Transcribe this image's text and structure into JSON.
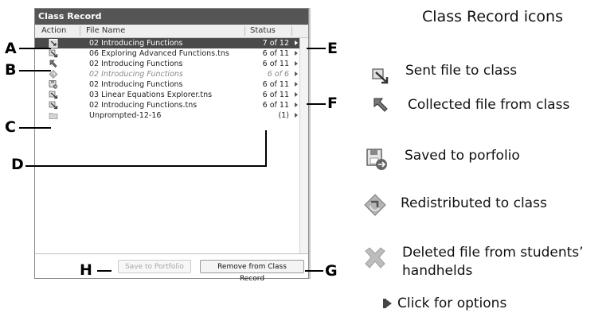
{
  "panel": {
    "title": "Class Record",
    "columns": {
      "action": "Action",
      "file_name": "File Name",
      "status": "Status"
    },
    "rows": [
      {
        "icon": "sent-file-icon-selected",
        "file": "02 Introducing Functions",
        "status": "7 of 12",
        "selected": true,
        "italic": false
      },
      {
        "icon": "sent-file-icon",
        "file": "06 Exploring Advanced Functions.tns",
        "status": "6 of 11",
        "selected": false,
        "italic": false
      },
      {
        "icon": "collected-file-icon",
        "file": "02 Introducing Functions",
        "status": "6 of 11",
        "selected": false,
        "italic": false
      },
      {
        "icon": "redistributed-icon",
        "file": "02 Introducing Functions",
        "status": "6 of 6",
        "selected": false,
        "italic": true
      },
      {
        "icon": "saved-portfolio-icon",
        "file": "02 Introducing Functions",
        "status": "6 of 11",
        "selected": false,
        "italic": false
      },
      {
        "icon": "sent-file-icon",
        "file": "03 Linear Equations Explorer.tns",
        "status": "6 of 11",
        "selected": false,
        "italic": false
      },
      {
        "icon": "sent-file-icon",
        "file": "02 Introducing Functions.tns",
        "status": "6 of 11",
        "selected": false,
        "italic": false
      },
      {
        "icon": "folder-icon",
        "file": "Unprompted-12-16",
        "status": "(1)",
        "selected": false,
        "italic": false
      }
    ],
    "buttons": {
      "save": "Save to Portfolio",
      "remove": "Remove from Class Record"
    }
  },
  "callouts": {
    "a": "A",
    "b": "B",
    "c": "C",
    "d": "D",
    "e": "E",
    "f": "F",
    "g": "G",
    "h": "H"
  },
  "legend": {
    "title": "Class Record icons",
    "items": [
      {
        "icon": "sent-file-icon",
        "label": "Sent file to class"
      },
      {
        "icon": "collected-file-icon",
        "label": "Collected file from class"
      },
      {
        "icon": "saved-portfolio-icon",
        "label": "Saved to porfolio"
      },
      {
        "icon": "redistributed-icon",
        "label": "Redistributed to class"
      },
      {
        "icon": "deleted-file-icon",
        "label_line1": "Deleted file from students’",
        "label_line2": "handhelds"
      },
      {
        "icon": "options-arrow-icon",
        "label": "Click for options"
      }
    ]
  }
}
